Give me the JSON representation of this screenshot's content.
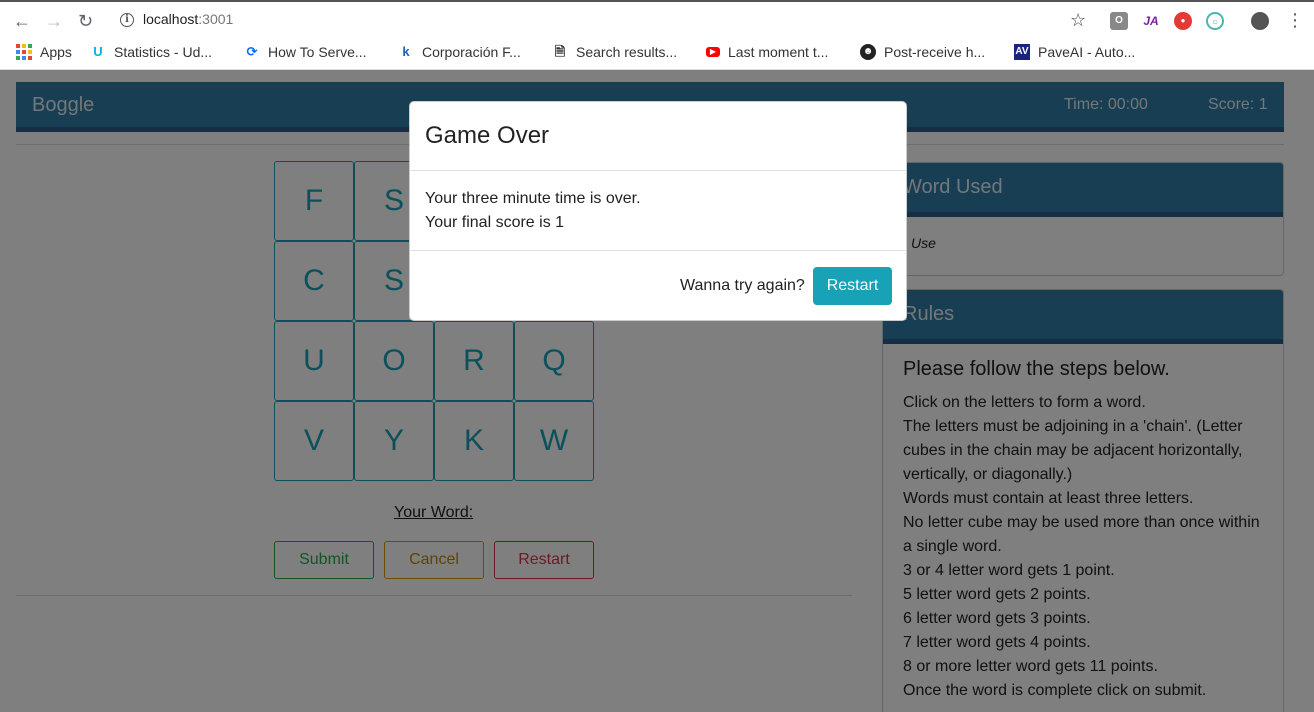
{
  "browser": {
    "url_host": "localhost",
    "url_port": ":3001",
    "bookmarks": [
      {
        "label": "Apps",
        "icon": "apps-grid-icon"
      },
      {
        "label": "Statistics - Ud...",
        "icon": "udacity-icon"
      },
      {
        "label": "How To Serve...",
        "icon": "digitalocean-icon"
      },
      {
        "label": "Corporación F...",
        "icon": "k-icon"
      },
      {
        "label": "Search results...",
        "icon": "page-icon"
      },
      {
        "label": "Last moment t...",
        "icon": "youtube-icon"
      },
      {
        "label": "Post-receive h...",
        "icon": "github-icon"
      },
      {
        "label": "PaveAI - Auto...",
        "icon": "paveai-icon"
      }
    ]
  },
  "navbar": {
    "brand": "Boggle",
    "time": "Time: 00:00",
    "score": "Score: 1"
  },
  "board": {
    "letters": [
      "F",
      "S",
      "",
      "",
      "C",
      "S",
      "",
      "",
      "U",
      "O",
      "R",
      "Q",
      "V",
      "Y",
      "K",
      "W"
    ]
  },
  "controls": {
    "your_word_label": "Your Word:",
    "submit": "Submit",
    "cancel": "Cancel",
    "restart": "Restart"
  },
  "words_card": {
    "title": "Word Used",
    "words": [
      "Use"
    ]
  },
  "rules_card": {
    "title": "Rules",
    "subtitle": "Please follow the steps below.",
    "lines": [
      "Click on the letters to form a word.",
      "The letters must be adjoining in a 'chain'. (Letter",
      "cubes in the chain may be adjacent horizontally,",
      "vertically, or diagonally.)",
      "Words must contain at least three letters.",
      "No letter cube may be used more than once within",
      "a single word.",
      "3 or 4 letter word gets 1 point.",
      "5 letter word gets 2 points.",
      "6 letter word gets 3 points.",
      "7 letter word gets 4 points.",
      "8 or more letter word gets 11 points.",
      "Once the word is complete click on submit."
    ]
  },
  "modal": {
    "title": "Game Over",
    "line1": "Your three minute time is over.",
    "line2": "Your final score is 1",
    "prompt": "Wanna try again?",
    "restart": "Restart"
  },
  "colors": {
    "primary": "#2e7da6",
    "info": "#17a2b8",
    "success": "#28a745",
    "warning": "#b58900",
    "danger": "#dc3545"
  }
}
